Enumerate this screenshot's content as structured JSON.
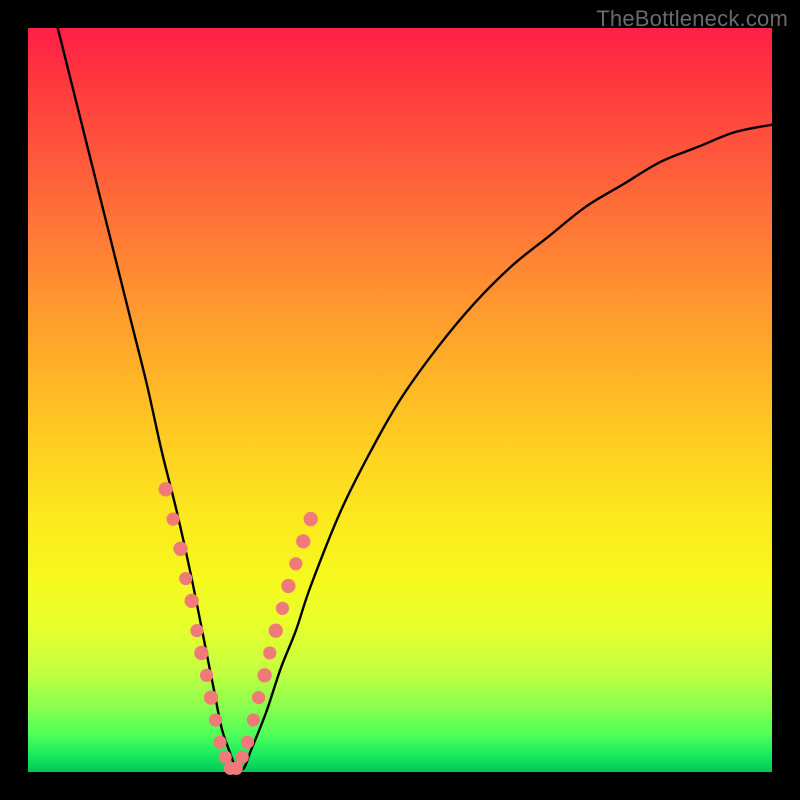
{
  "watermark": "TheBottleneck.com",
  "chart_data": {
    "type": "line",
    "title": "",
    "xlabel": "",
    "ylabel": "",
    "xlim": [
      0,
      100
    ],
    "ylim": [
      0,
      100
    ],
    "grid": false,
    "legend": false,
    "series": [
      {
        "name": "curve",
        "type": "line",
        "color": "#000000",
        "x": [
          4,
          6,
          8,
          10,
          12,
          14,
          16,
          18,
          20,
          22,
          24,
          25,
          26,
          27,
          28,
          29,
          30,
          32,
          34,
          36,
          38,
          42,
          46,
          50,
          55,
          60,
          65,
          70,
          75,
          80,
          85,
          90,
          95,
          100
        ],
        "y": [
          100,
          92,
          84,
          76,
          68,
          60,
          52,
          43,
          35,
          26,
          16,
          11,
          6,
          3,
          0.5,
          0.5,
          3,
          8,
          14,
          19,
          25,
          35,
          43,
          50,
          57,
          63,
          68,
          72,
          76,
          79,
          82,
          84,
          86,
          87
        ]
      },
      {
        "name": "marker-dots",
        "type": "scatter",
        "color": "#f07a78",
        "x": [
          18.5,
          19.5,
          20.5,
          21.2,
          22.0,
          22.7,
          23.3,
          24.0,
          24.6,
          25.2,
          25.8,
          26.5,
          27.2,
          28.0,
          28.8,
          29.5,
          30.3,
          31.0,
          31.8,
          32.5,
          33.3,
          34.2,
          35.0,
          36.0,
          37.0,
          38.0
        ],
        "y": [
          38,
          34,
          30,
          26,
          23,
          19,
          16,
          13,
          10,
          7,
          4,
          2,
          0.5,
          0.5,
          2,
          4,
          7,
          10,
          13,
          16,
          19,
          22,
          25,
          28,
          31,
          34
        ],
        "size": [
          13,
          12,
          13,
          12,
          13,
          12,
          13,
          12,
          13,
          12,
          12,
          12,
          12,
          12,
          12,
          12,
          12,
          12,
          13,
          12,
          13,
          12,
          13,
          12,
          13,
          13
        ]
      }
    ]
  }
}
